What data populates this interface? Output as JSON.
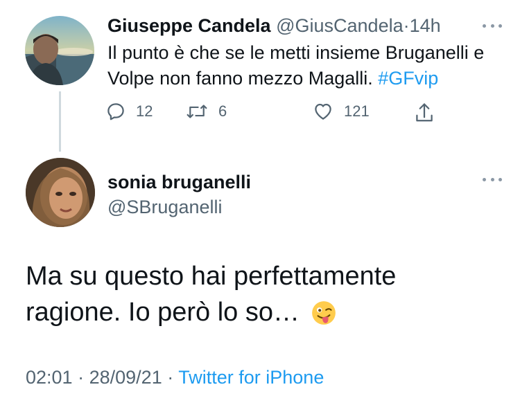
{
  "colors": {
    "text": "#0f1419",
    "secondary": "#536471",
    "accent": "#1d9bf0",
    "thread_line": "#cfd9de"
  },
  "reply_tweet": {
    "author_name": "Giuseppe Candela",
    "author_handle": "@GiusCandela",
    "separator": "·",
    "time": "14h",
    "text": "Il punto è che se le metti insieme Bruganelli e Volpe non fanno mezzo Magalli.",
    "hashtag": "#GFvip",
    "more_icon": "more-horizontal-icon",
    "actions": {
      "reply": {
        "icon": "reply-icon",
        "count": "12"
      },
      "retweet": {
        "icon": "retweet-icon",
        "count": "6"
      },
      "like": {
        "icon": "heart-icon",
        "count": "121"
      },
      "share": {
        "icon": "share-icon"
      }
    }
  },
  "main_tweet": {
    "author_name": "sonia bruganelli",
    "author_handle": "@SBruganelli",
    "text": "Ma su questo hai perfettamente ragione. Io però lo so…",
    "emoji": "winking-face-with-tongue",
    "more_icon": "more-horizontal-icon",
    "time": "02:01",
    "separator1": "·",
    "date": "28/09/21",
    "separator2": "·",
    "source": "Twitter for iPhone"
  }
}
